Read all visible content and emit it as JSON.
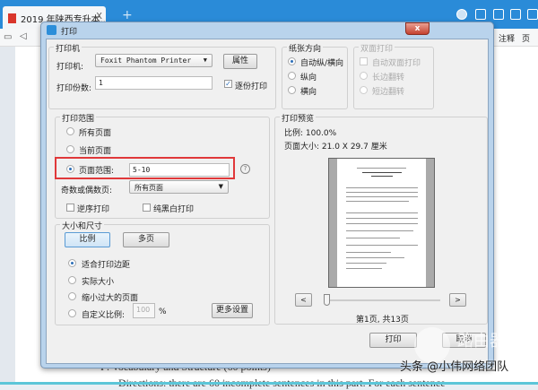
{
  "browser": {
    "tab_title": "2019 年陕西专升本...",
    "tab_close": "X",
    "new_tab": "+",
    "toolbar_right": [
      "注释",
      "页"
    ]
  },
  "document": {
    "line1": "I . Vocabulary and Structure (60 points)",
    "line2": "Directions: there are 60 incomplete sentences in this part. For each sentence"
  },
  "watermark": {
    "site": "路由器",
    "credit": "头条 @小伟网络团队"
  },
  "dialog": {
    "title": "打印",
    "close": "x",
    "printer": {
      "legend": "打印机",
      "printer_label": "打印机:",
      "printer_value": "Foxit Phantom Printer",
      "properties": "属性",
      "copies_label": "打印份数:",
      "copies_value": "1",
      "collate": "逐份打印",
      "collate_checked": true
    },
    "orientation": {
      "legend": "纸张方向",
      "options": [
        "自动纵/横向",
        "纵向",
        "横向"
      ],
      "selected": 0
    },
    "duplex": {
      "legend": "双面打印",
      "auto": "自动双面打印",
      "long": "长边翻转",
      "short": "短边翻转"
    },
    "range": {
      "legend": "打印范围",
      "all": "所有页面",
      "current": "当前页面",
      "pages_label": "页面范围:",
      "pages_value": "5-10",
      "help": "?",
      "odd_even_label": "奇数或偶数页:",
      "odd_even_value": "所有页面",
      "reverse": "逆序打印",
      "grayscale": "纯黑白打印"
    },
    "size": {
      "legend": "大小和尺寸",
      "scale_btn": "比例",
      "multi_btn": "多页",
      "options": [
        "适合打印边距",
        "实际大小",
        "缩小过大的页面",
        "自定义比例:"
      ],
      "selected": 0,
      "custom_value": "100",
      "percent": "%",
      "more": "更多设置"
    },
    "preview": {
      "legend": "打印预览",
      "scale": "比例: 100.0%",
      "page_size": "页面大小: 21.0 X 29.7 厘米",
      "prev": "<",
      "next": ">",
      "page_info": "第1页, 共13页",
      "slider_position": 0
    },
    "print_btn": "打印",
    "cancel_btn": "取消"
  },
  "colors": {
    "accent": "#2a8bd8",
    "highlight": "#e0383a"
  }
}
